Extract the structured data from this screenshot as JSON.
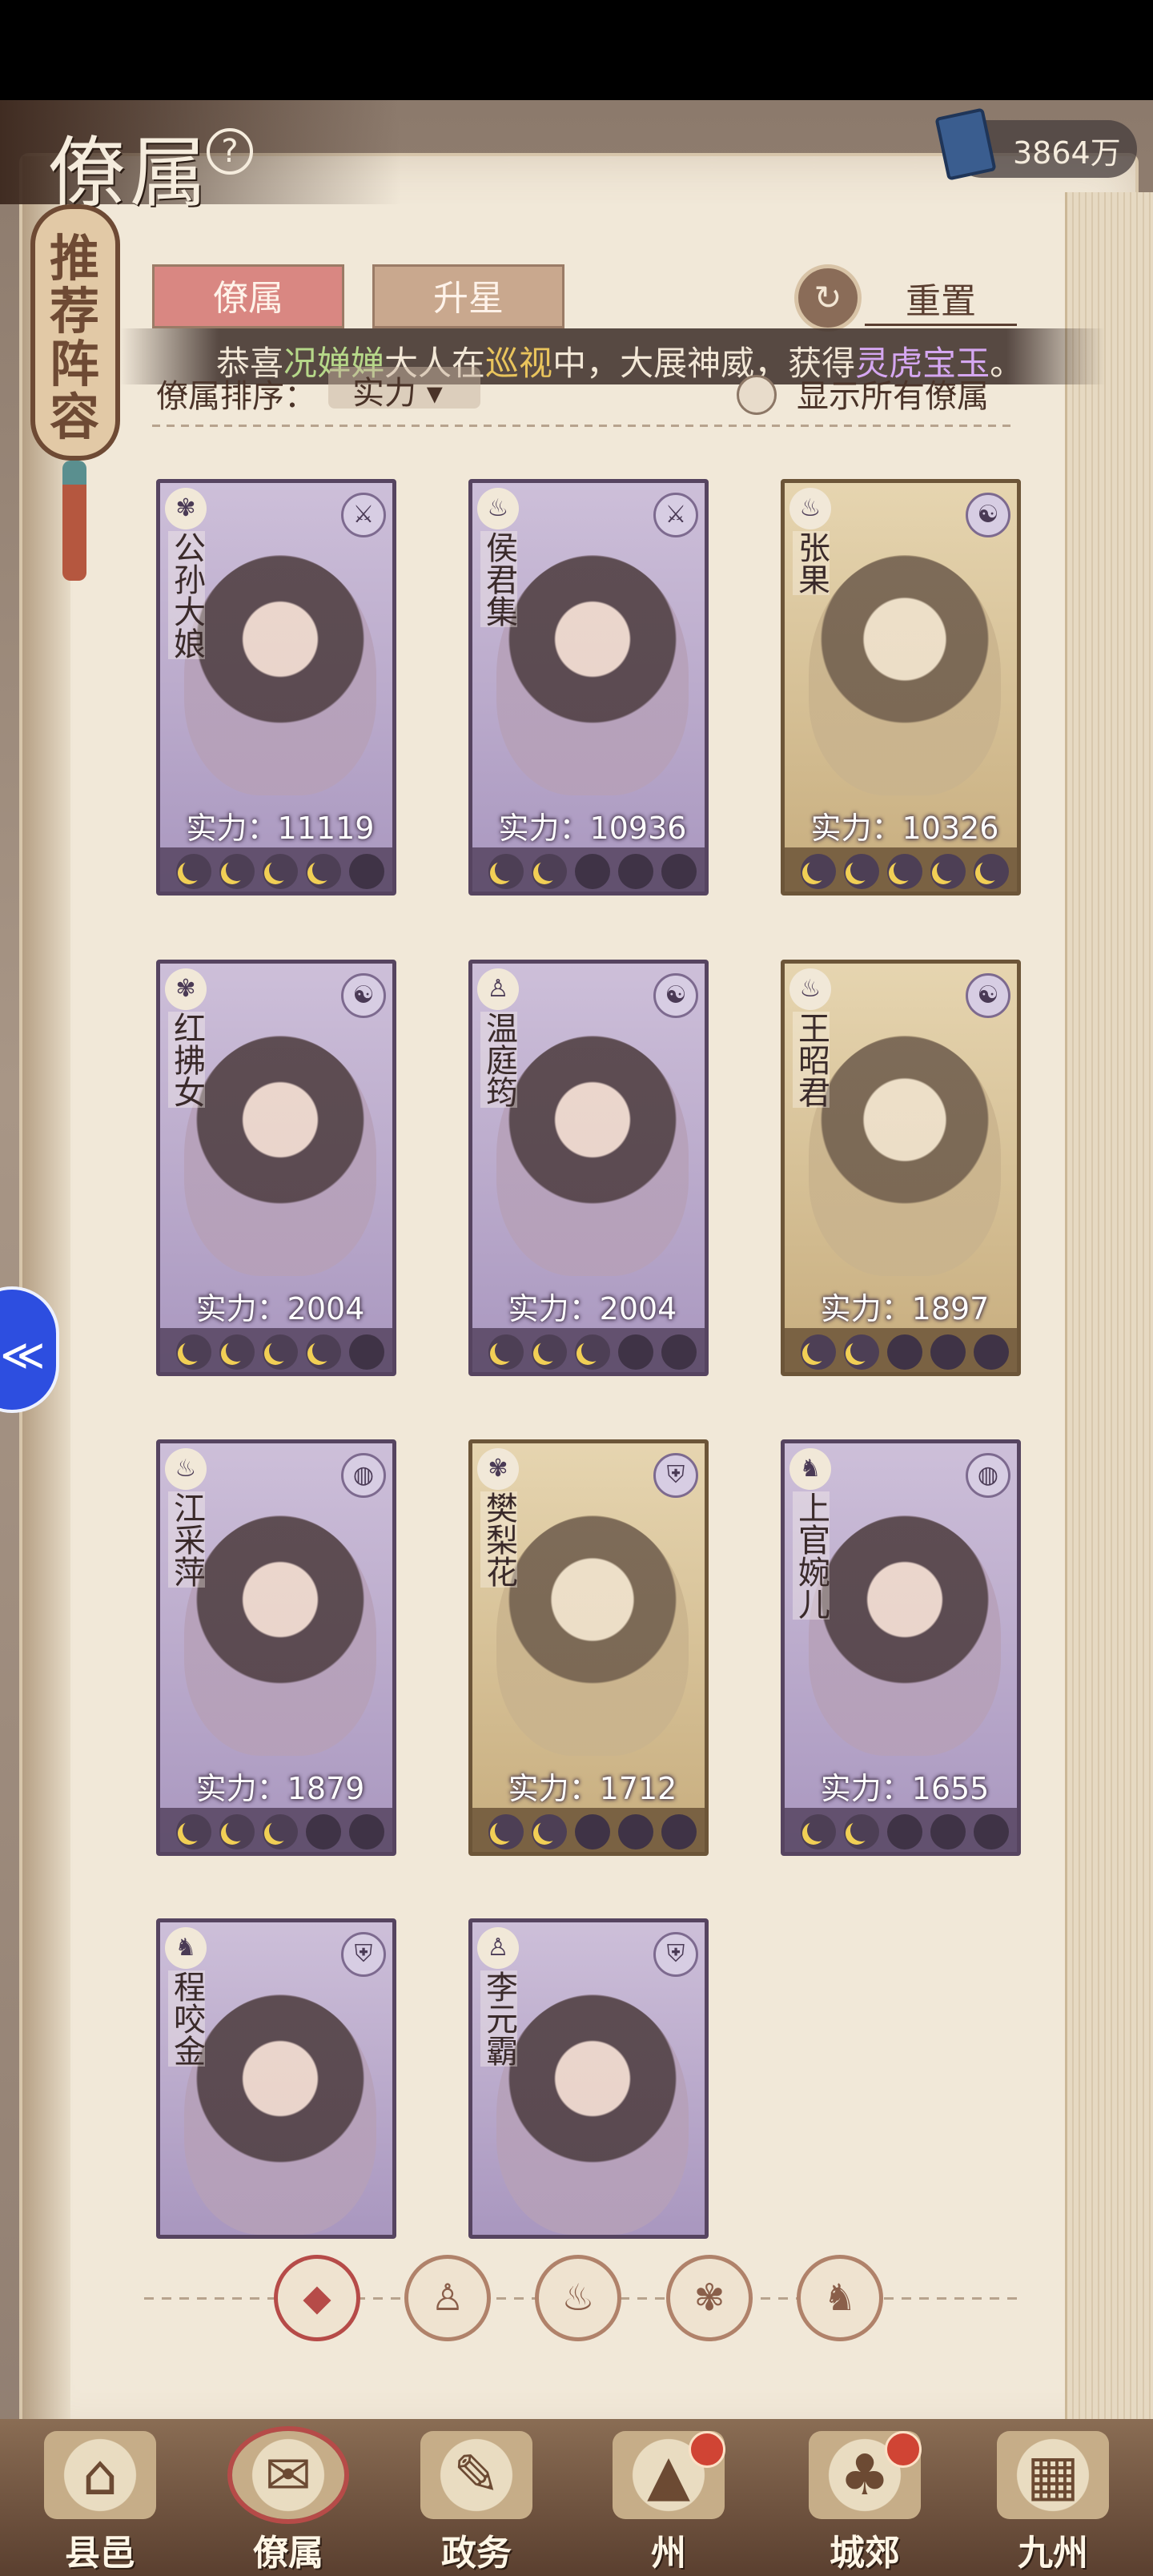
{
  "header": {
    "title": "僚属",
    "help_icon": "?",
    "currency_value": "3864万"
  },
  "lineup_button": {
    "label": "推荐阵容"
  },
  "tabs": [
    {
      "label": "僚属",
      "active": true
    },
    {
      "label": "升星",
      "active": false
    }
  ],
  "reset": {
    "icon": "↻",
    "label": "重置"
  },
  "marquee": {
    "prefix": "恭喜",
    "name": "况婵婵",
    "mid1": "大人在",
    "action": "巡视",
    "mid2": "中，大展神威，获得",
    "item": "灵虎宝玉",
    "suffix": "。"
  },
  "sort": {
    "label": "僚属排序：",
    "selected": "实力",
    "show_all_label": "显示所有僚属"
  },
  "colors": {
    "purple_card": "#a997bf",
    "gold_card": "#c7ad7e",
    "accent_red": "#b64b48",
    "moon_yellow": "#f1cf55"
  },
  "cards": [
    {
      "name": "公孙大娘",
      "power_label": "实力：11119",
      "rarity": "purple",
      "type_icon": "fan-icon",
      "role_icon": "sword-icon",
      "moons_total": 5,
      "moons_lit": 4
    },
    {
      "name": "侯君集",
      "power_label": "实力：10936",
      "rarity": "purple",
      "type_icon": "gourd-icon",
      "role_icon": "sword-icon",
      "moons_total": 5,
      "moons_lit": 2
    },
    {
      "name": "张果",
      "power_label": "实力：10326",
      "rarity": "gold",
      "type_icon": "gourd-icon",
      "role_icon": "yinyang-icon",
      "moons_total": 5,
      "moons_lit": 5
    },
    {
      "name": "红拂女",
      "power_label": "实力：2004",
      "rarity": "purple",
      "type_icon": "fan-icon",
      "role_icon": "yinyang-icon",
      "moons_total": 5,
      "moons_lit": 4
    },
    {
      "name": "温庭筠",
      "power_label": "实力：2004",
      "rarity": "purple",
      "type_icon": "bell-icon",
      "role_icon": "yinyang-icon",
      "moons_total": 5,
      "moons_lit": 3
    },
    {
      "name": "王昭君",
      "power_label": "实力：1897",
      "rarity": "gold",
      "type_icon": "gourd-icon",
      "role_icon": "yinyang-icon",
      "moons_total": 5,
      "moons_lit": 2
    },
    {
      "name": "江采萍",
      "power_label": "实力：1879",
      "rarity": "purple",
      "type_icon": "gourd-icon",
      "role_icon": "drum-icon",
      "moons_total": 5,
      "moons_lit": 3
    },
    {
      "name": "樊梨花",
      "power_label": "实力：1712",
      "rarity": "gold",
      "type_icon": "fan-icon",
      "role_icon": "shield-icon",
      "moons_total": 5,
      "moons_lit": 2
    },
    {
      "name": "上官婉儿",
      "power_label": "实力：1655",
      "rarity": "purple",
      "type_icon": "monkey-icon",
      "role_icon": "drum-icon",
      "moons_total": 5,
      "moons_lit": 2
    },
    {
      "name": "程咬金",
      "power_label": "",
      "rarity": "purple",
      "type_icon": "monkey-icon",
      "role_icon": "shield-icon",
      "moons_total": 0,
      "moons_lit": 0
    },
    {
      "name": "李元霸",
      "power_label": "",
      "rarity": "purple",
      "type_icon": "bell-icon",
      "role_icon": "shield-icon",
      "moons_total": 0,
      "moons_lit": 0
    }
  ],
  "filters": [
    {
      "icon": "diamond-icon",
      "glyph": "◆",
      "active": true
    },
    {
      "icon": "bell-icon",
      "glyph": "♙",
      "active": false
    },
    {
      "icon": "gourd-icon",
      "glyph": "♨",
      "active": false
    },
    {
      "icon": "fan-icon",
      "glyph": "✾",
      "active": false
    },
    {
      "icon": "monkey-icon",
      "glyph": "♞",
      "active": false
    }
  ],
  "bottom_nav": [
    {
      "label": "县邑",
      "glyph": "⌂",
      "notify": false,
      "active": false
    },
    {
      "label": "僚属",
      "glyph": "✉",
      "notify": false,
      "active": true
    },
    {
      "label": "政务",
      "glyph": "✎",
      "notify": false,
      "active": false
    },
    {
      "label": "州",
      "glyph": "▲",
      "notify": true,
      "active": false
    },
    {
      "label": "城郊",
      "glyph": "♣",
      "notify": true,
      "active": false
    },
    {
      "label": "九州",
      "glyph": "▦",
      "notify": false,
      "active": false
    }
  ],
  "side_button": {
    "glyph": "≪"
  }
}
